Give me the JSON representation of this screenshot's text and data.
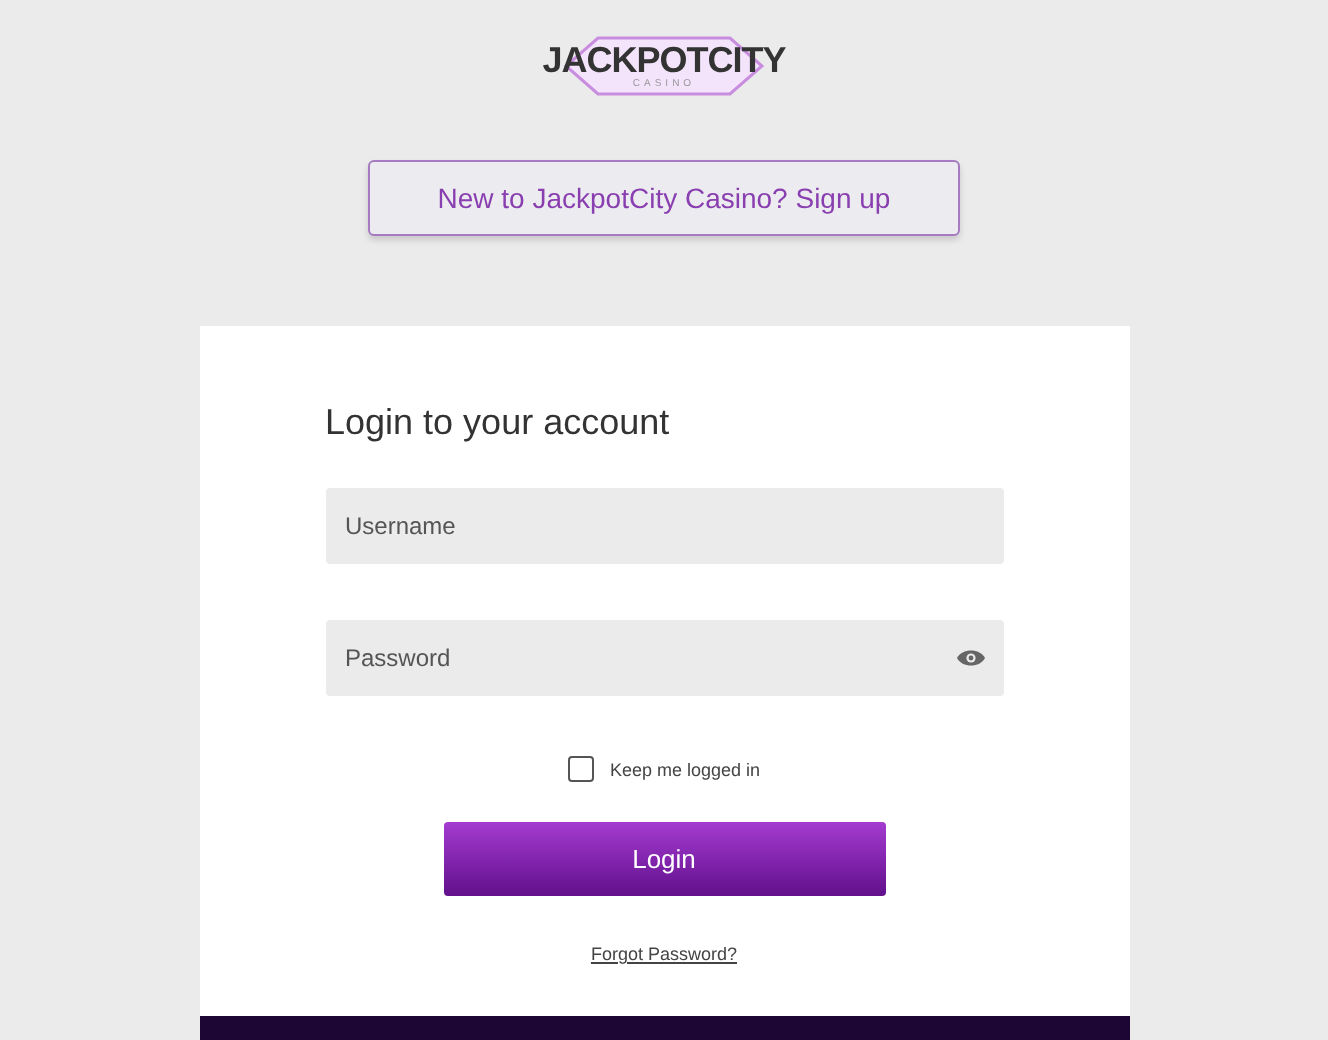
{
  "logo": {
    "name": "JACKPOTCITY",
    "tagline": "CASINO"
  },
  "signup_button": "New to JackpotCity Casino? Sign up",
  "login_form": {
    "title": "Login to your account",
    "username": {
      "placeholder": "Username"
    },
    "password": {
      "placeholder": "Password"
    },
    "remember": {
      "label": "Keep me logged in",
      "checked": false
    },
    "submit": "Login",
    "forgot_link": "Forgot Password?"
  }
}
